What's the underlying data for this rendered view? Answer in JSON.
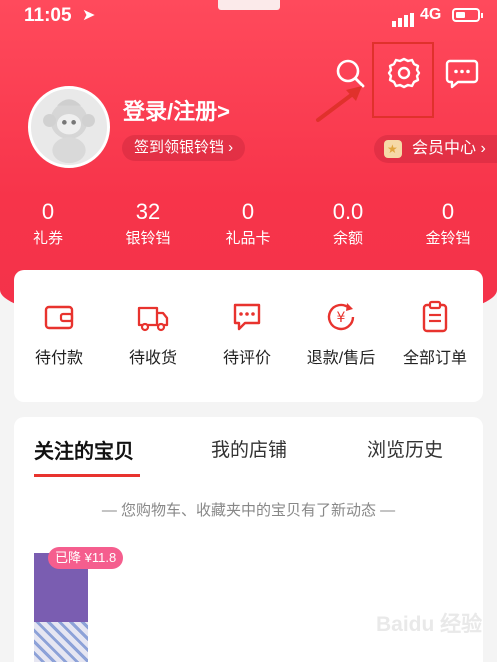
{
  "status_bar": {
    "time": "11:05",
    "location_glyph": "➤",
    "network": "4G"
  },
  "header": {
    "icons": [
      "search-icon",
      "gear-icon",
      "message-icon"
    ],
    "login_label": "登录/注册>",
    "signin_pill": "签到领银铃铛 ›",
    "member_center": "会员中心 ›"
  },
  "stats": [
    {
      "value": "0",
      "label": "礼券"
    },
    {
      "value": "32",
      "label": "银铃铛"
    },
    {
      "value": "0",
      "label": "礼品卡"
    },
    {
      "value": "0.0",
      "label": "余额"
    },
    {
      "value": "0",
      "label": "金铃铛"
    }
  ],
  "orders": [
    {
      "label": "待付款",
      "icon": "wallet-icon"
    },
    {
      "label": "待收货",
      "icon": "truck-icon"
    },
    {
      "label": "待评价",
      "icon": "comment-icon"
    },
    {
      "label": "退款/售后",
      "icon": "refund-icon"
    },
    {
      "label": "全部订单",
      "icon": "clipboard-icon"
    }
  ],
  "tabs": [
    {
      "label": "关注的宝贝",
      "active": true
    },
    {
      "label": "我的店铺",
      "active": false
    },
    {
      "label": "浏览历史",
      "active": false
    }
  ],
  "notice": "— 您购物车、收藏夹中的宝贝有了新动态 —",
  "product": {
    "price_tag": "已降 ¥11.8"
  },
  "watermark": "Baidu 经验",
  "colors": {
    "brand_red": "#f3324a",
    "accent_red": "#e8332e",
    "price_pink": "#f55e8e"
  }
}
